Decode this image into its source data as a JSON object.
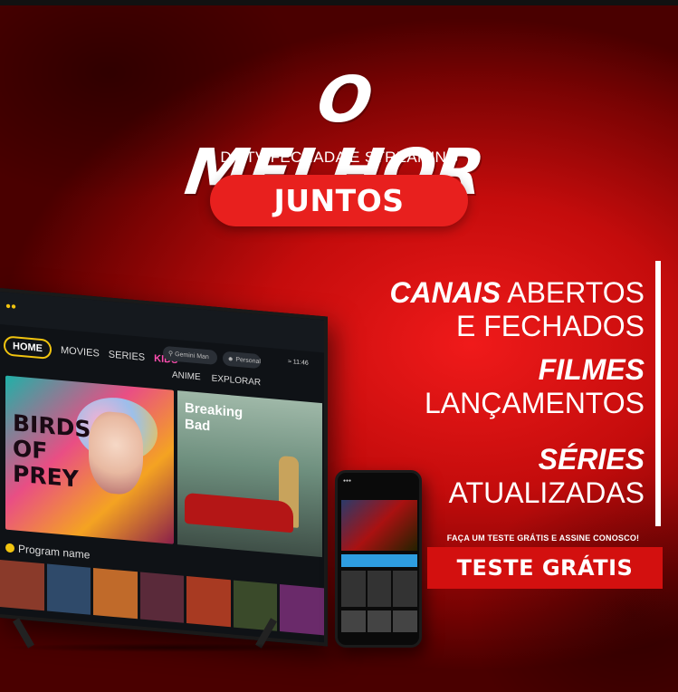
{
  "headline": "O MELHOR",
  "subheadline": "DA TV FECHADA E STREAMING",
  "pill_label": "JUNTOS",
  "features": [
    {
      "bold": "CANAIS",
      "light": "ABERTOS"
    },
    {
      "bold": "",
      "light": "E FECHADOS"
    },
    {
      "bold": "FILMES",
      "light": ""
    },
    {
      "bold": "",
      "light": "LANÇAMENTOS"
    },
    {
      "bold": "SÉRIES",
      "light": ""
    },
    {
      "bold": "",
      "light": "ATUALIZADAS"
    }
  ],
  "cta": {
    "small_text": "FAÇA UM TESTE GRÁTIS E ASSINE CONOSCO!",
    "button_label": "TESTE GRÁTIS"
  },
  "tv": {
    "nav": [
      "HOME",
      "MOVIES",
      "SERIES",
      "KIDS"
    ],
    "subnav": [
      "ANIME",
      "EXPLORAR"
    ],
    "search_placeholder": "Gemini Man",
    "personal": "Personal",
    "time": "11:46",
    "cards": {
      "birds_title": "BIRDS OF PREY",
      "bad_title_1": "Breaking",
      "bad_title_2": "Bad"
    },
    "program_label": "Program name"
  },
  "colors": {
    "background_red": "#c40c0c",
    "pill_red": "#e8201e",
    "cta_red": "#d3100f",
    "tv_home_outline": "#f1c40f",
    "text": "#ffffff"
  }
}
